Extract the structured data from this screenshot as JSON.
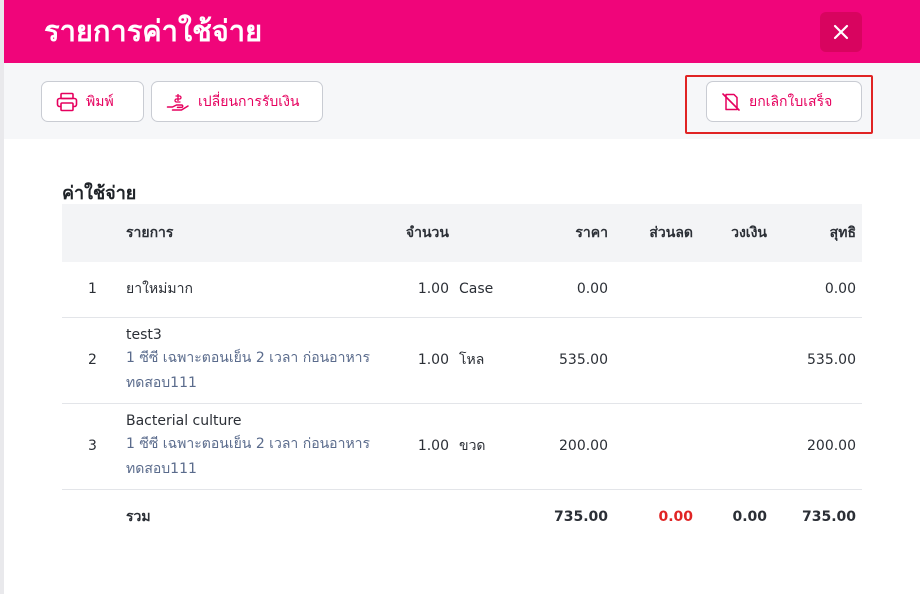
{
  "header": {
    "title": "รายการค่าใช้จ่าย"
  },
  "toolbar": {
    "print_label": "พิมพ์",
    "change_payment_label": "เปลี่ยนการรับเงิน",
    "cancel_receipt_label": "ยกเลิกใบเสร็จ"
  },
  "section": {
    "title": "ค่าใช้จ่าย"
  },
  "table": {
    "headers": {
      "item": "รายการ",
      "qty": "จำนวน",
      "price": "ราคา",
      "discount": "ส่วนลด",
      "limit": "วงเงิน",
      "net": "สุทธิ"
    },
    "rows": [
      {
        "no": "1",
        "name": "ยาใหม่มาก",
        "sub1": "",
        "sub2": "",
        "qty": "1.00",
        "unit": "Case",
        "price": "0.00",
        "discount": "",
        "limit": "",
        "net": "0.00"
      },
      {
        "no": "2",
        "name": "test3",
        "sub1": "1 ซีซี เฉพาะตอนเย็น 2 เวลา ก่อนอาหาร",
        "sub2": "ทดสอบ111",
        "qty": "1.00",
        "unit": "โหล",
        "price": "535.00",
        "discount": "",
        "limit": "",
        "net": "535.00"
      },
      {
        "no": "3",
        "name": "Bacterial culture",
        "sub1": "1 ซีซี เฉพาะตอนเย็น 2 เวลา ก่อนอาหาร",
        "sub2": "ทดสอบ111",
        "qty": "1.00",
        "unit": "ขวด",
        "price": "200.00",
        "discount": "",
        "limit": "",
        "net": "200.00"
      }
    ],
    "total": {
      "label": "รวม",
      "price": "735.00",
      "discount": "0.00",
      "limit": "0.00",
      "net": "735.00"
    }
  },
  "colors": {
    "brand": "#f0057a",
    "accent": "#e6005e",
    "highlight": "#e02424"
  },
  "icons": {
    "close": "close-icon",
    "print": "printer-icon",
    "payment": "hand-coin-icon",
    "cancel": "receipt-off-icon"
  }
}
